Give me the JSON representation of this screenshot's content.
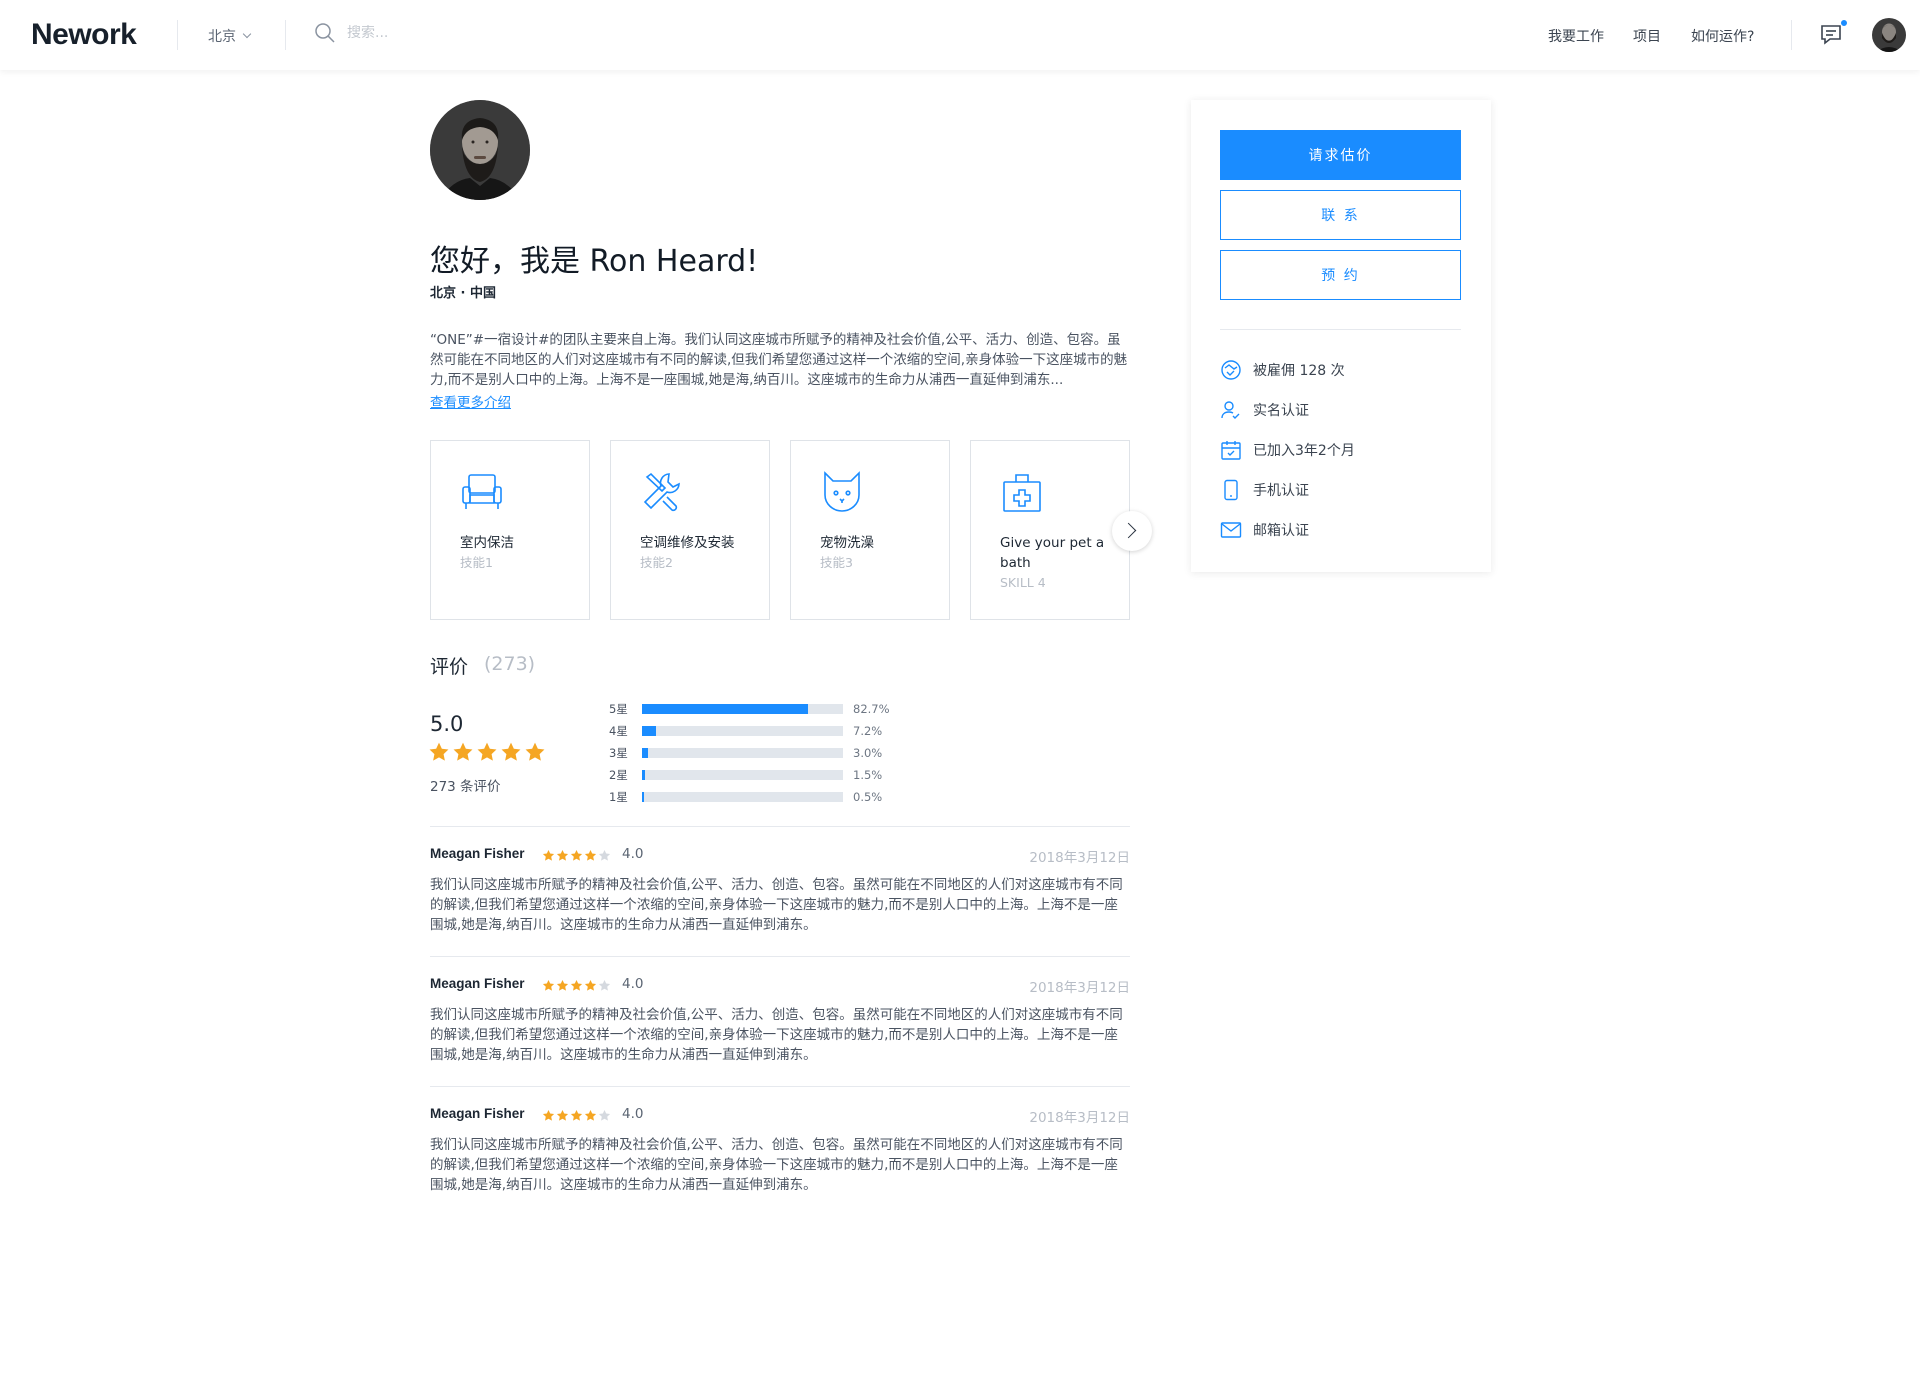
{
  "header": {
    "logo": "Nework",
    "city": "北京",
    "search_placeholder": "搜索...",
    "nav": [
      "我要工作",
      "项目",
      "如何运作?"
    ]
  },
  "profile": {
    "greeting": "您好，我是 Ron Heard!",
    "location": "北京 · 中国",
    "intro": "“ONE”#一宿设计#的团队主要来自上海。我们认同这座城市所赋予的精神及社会价值,公平、活力、创造、包容。虽然可能在不同地区的人们对这座城市有不同的解读,但我们希望您通过这样一个浓缩的空间,亲身体验一下这座城市的魅力,而不是别人口中的上海。上海不是一座围城,她是海,纳百川。这座城市的生命力从浦西一直延伸到浦东...",
    "more_link": "查看更多介绍"
  },
  "skills": [
    {
      "name": "室内保洁",
      "sub": "技能1",
      "icon": "sofa-icon"
    },
    {
      "name": "空调维修及安装",
      "sub": "技能2",
      "icon": "tools-icon"
    },
    {
      "name": "宠物洗澡",
      "sub": "技能3",
      "icon": "cat-icon"
    },
    {
      "name": "Give your pet a bath",
      "sub": "SKILL 4",
      "icon": "medical-kit-icon"
    }
  ],
  "reviews_summary": {
    "title": "评价",
    "count": "(273)",
    "score": "5.0",
    "stars": 5,
    "total": "273 条评价",
    "distribution": [
      {
        "label": "5星",
        "percent": 82.7,
        "pct_text": "82.7%"
      },
      {
        "label": "4星",
        "percent": 7.2,
        "pct_text": "7.2%"
      },
      {
        "label": "3星",
        "percent": 3.0,
        "pct_text": "3.0%"
      },
      {
        "label": "2星",
        "percent": 1.5,
        "pct_text": "1.5%"
      },
      {
        "label": "1星",
        "percent": 0.5,
        "pct_text": "0.5%"
      }
    ]
  },
  "reviews": [
    {
      "author": "Meagan Fisher",
      "stars": 4,
      "rating": "4.0",
      "date": "2018年3月12日",
      "text": "我们认同这座城市所赋予的精神及社会价值,公平、活力、创造、包容。虽然可能在不同地区的人们对这座城市有不同的解读,但我们希望您通过这样一个浓缩的空间,亲身体验一下这座城市的魅力,而不是别人口中的上海。上海不是一座围城,她是海,纳百川。这座城市的生命力从浦西一直延伸到浦东。"
    },
    {
      "author": "Meagan Fisher",
      "stars": 4,
      "rating": "4.0",
      "date": "2018年3月12日",
      "text": "我们认同这座城市所赋予的精神及社会价值,公平、活力、创造、包容。虽然可能在不同地区的人们对这座城市有不同的解读,但我们希望您通过这样一个浓缩的空间,亲身体验一下这座城市的魅力,而不是别人口中的上海。上海不是一座围城,她是海,纳百川。这座城市的生命力从浦西一直延伸到浦东。"
    },
    {
      "author": "Meagan Fisher",
      "stars": 4,
      "rating": "4.0",
      "date": "2018年3月12日",
      "text": "我们认同这座城市所赋予的精神及社会价值,公平、活力、创造、包容。虽然可能在不同地区的人们对这座城市有不同的解读,但我们希望您通过这样一个浓缩的空间,亲身体验一下这座城市的魅力,而不是别人口中的上海。上海不是一座围城,她是海,纳百川。这座城市的生命力从浦西一直延伸到浦东。"
    }
  ],
  "sidebar": {
    "request_quote": "请求估价",
    "contact": "联 系",
    "book": "预 约",
    "info": [
      {
        "icon": "handshake-icon",
        "text": "被雇佣 128 次"
      },
      {
        "icon": "user-verified-icon",
        "text": "实名认证"
      },
      {
        "icon": "calendar-icon",
        "text": "已加入3年2个月"
      },
      {
        "icon": "phone-icon",
        "text": "手机认证"
      },
      {
        "icon": "mail-icon",
        "text": "邮箱认证"
      }
    ]
  },
  "colors": {
    "accent": "#1a8cff",
    "star": "#f5a623",
    "star_empty": "#d5d9df"
  }
}
